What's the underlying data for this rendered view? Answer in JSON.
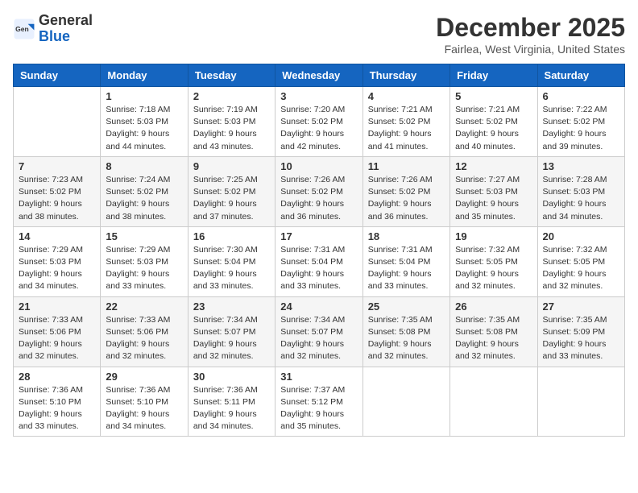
{
  "header": {
    "logo_general": "General",
    "logo_blue": "Blue",
    "month": "December 2025",
    "location": "Fairlea, West Virginia, United States"
  },
  "weekdays": [
    "Sunday",
    "Monday",
    "Tuesday",
    "Wednesday",
    "Thursday",
    "Friday",
    "Saturday"
  ],
  "weeks": [
    [
      {
        "day": "",
        "info": ""
      },
      {
        "day": "1",
        "info": "Sunrise: 7:18 AM\nSunset: 5:03 PM\nDaylight: 9 hours\nand 44 minutes."
      },
      {
        "day": "2",
        "info": "Sunrise: 7:19 AM\nSunset: 5:03 PM\nDaylight: 9 hours\nand 43 minutes."
      },
      {
        "day": "3",
        "info": "Sunrise: 7:20 AM\nSunset: 5:02 PM\nDaylight: 9 hours\nand 42 minutes."
      },
      {
        "day": "4",
        "info": "Sunrise: 7:21 AM\nSunset: 5:02 PM\nDaylight: 9 hours\nand 41 minutes."
      },
      {
        "day": "5",
        "info": "Sunrise: 7:21 AM\nSunset: 5:02 PM\nDaylight: 9 hours\nand 40 minutes."
      },
      {
        "day": "6",
        "info": "Sunrise: 7:22 AM\nSunset: 5:02 PM\nDaylight: 9 hours\nand 39 minutes."
      }
    ],
    [
      {
        "day": "7",
        "info": "Sunrise: 7:23 AM\nSunset: 5:02 PM\nDaylight: 9 hours\nand 38 minutes."
      },
      {
        "day": "8",
        "info": "Sunrise: 7:24 AM\nSunset: 5:02 PM\nDaylight: 9 hours\nand 38 minutes."
      },
      {
        "day": "9",
        "info": "Sunrise: 7:25 AM\nSunset: 5:02 PM\nDaylight: 9 hours\nand 37 minutes."
      },
      {
        "day": "10",
        "info": "Sunrise: 7:26 AM\nSunset: 5:02 PM\nDaylight: 9 hours\nand 36 minutes."
      },
      {
        "day": "11",
        "info": "Sunrise: 7:26 AM\nSunset: 5:02 PM\nDaylight: 9 hours\nand 36 minutes."
      },
      {
        "day": "12",
        "info": "Sunrise: 7:27 AM\nSunset: 5:03 PM\nDaylight: 9 hours\nand 35 minutes."
      },
      {
        "day": "13",
        "info": "Sunrise: 7:28 AM\nSunset: 5:03 PM\nDaylight: 9 hours\nand 34 minutes."
      }
    ],
    [
      {
        "day": "14",
        "info": "Sunrise: 7:29 AM\nSunset: 5:03 PM\nDaylight: 9 hours\nand 34 minutes."
      },
      {
        "day": "15",
        "info": "Sunrise: 7:29 AM\nSunset: 5:03 PM\nDaylight: 9 hours\nand 33 minutes."
      },
      {
        "day": "16",
        "info": "Sunrise: 7:30 AM\nSunset: 5:04 PM\nDaylight: 9 hours\nand 33 minutes."
      },
      {
        "day": "17",
        "info": "Sunrise: 7:31 AM\nSunset: 5:04 PM\nDaylight: 9 hours\nand 33 minutes."
      },
      {
        "day": "18",
        "info": "Sunrise: 7:31 AM\nSunset: 5:04 PM\nDaylight: 9 hours\nand 33 minutes."
      },
      {
        "day": "19",
        "info": "Sunrise: 7:32 AM\nSunset: 5:05 PM\nDaylight: 9 hours\nand 32 minutes."
      },
      {
        "day": "20",
        "info": "Sunrise: 7:32 AM\nSunset: 5:05 PM\nDaylight: 9 hours\nand 32 minutes."
      }
    ],
    [
      {
        "day": "21",
        "info": "Sunrise: 7:33 AM\nSunset: 5:06 PM\nDaylight: 9 hours\nand 32 minutes."
      },
      {
        "day": "22",
        "info": "Sunrise: 7:33 AM\nSunset: 5:06 PM\nDaylight: 9 hours\nand 32 minutes."
      },
      {
        "day": "23",
        "info": "Sunrise: 7:34 AM\nSunset: 5:07 PM\nDaylight: 9 hours\nand 32 minutes."
      },
      {
        "day": "24",
        "info": "Sunrise: 7:34 AM\nSunset: 5:07 PM\nDaylight: 9 hours\nand 32 minutes."
      },
      {
        "day": "25",
        "info": "Sunrise: 7:35 AM\nSunset: 5:08 PM\nDaylight: 9 hours\nand 32 minutes."
      },
      {
        "day": "26",
        "info": "Sunrise: 7:35 AM\nSunset: 5:08 PM\nDaylight: 9 hours\nand 32 minutes."
      },
      {
        "day": "27",
        "info": "Sunrise: 7:35 AM\nSunset: 5:09 PM\nDaylight: 9 hours\nand 33 minutes."
      }
    ],
    [
      {
        "day": "28",
        "info": "Sunrise: 7:36 AM\nSunset: 5:10 PM\nDaylight: 9 hours\nand 33 minutes."
      },
      {
        "day": "29",
        "info": "Sunrise: 7:36 AM\nSunset: 5:10 PM\nDaylight: 9 hours\nand 34 minutes."
      },
      {
        "day": "30",
        "info": "Sunrise: 7:36 AM\nSunset: 5:11 PM\nDaylight: 9 hours\nand 34 minutes."
      },
      {
        "day": "31",
        "info": "Sunrise: 7:37 AM\nSunset: 5:12 PM\nDaylight: 9 hours\nand 35 minutes."
      },
      {
        "day": "",
        "info": ""
      },
      {
        "day": "",
        "info": ""
      },
      {
        "day": "",
        "info": ""
      }
    ]
  ]
}
